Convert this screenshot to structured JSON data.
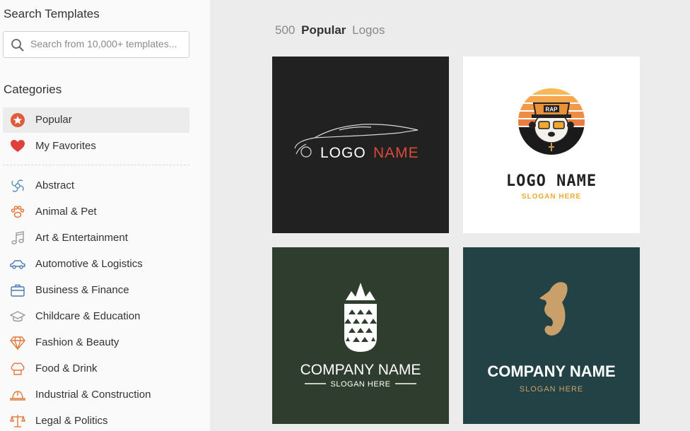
{
  "sidebar": {
    "search_title": "Search Templates",
    "search_placeholder": "Search from 10,000+ templates...",
    "categories_title": "Categories",
    "top_items": [
      {
        "label": "Popular",
        "icon": "star-badge-icon"
      },
      {
        "label": "My Favorites",
        "icon": "heart-icon"
      }
    ],
    "items": [
      {
        "label": "Abstract",
        "icon": "abstract-swirl-icon"
      },
      {
        "label": "Animal & Pet",
        "icon": "paw-icon"
      },
      {
        "label": "Art & Entertainment",
        "icon": "music-note-icon"
      },
      {
        "label": "Automotive & Logistics",
        "icon": "car-icon"
      },
      {
        "label": "Business & Finance",
        "icon": "briefcase-icon"
      },
      {
        "label": "Childcare & Education",
        "icon": "graduation-cap-icon"
      },
      {
        "label": "Fashion & Beauty",
        "icon": "diamond-icon"
      },
      {
        "label": "Food & Drink",
        "icon": "chef-hat-icon"
      },
      {
        "label": "Industrial & Construction",
        "icon": "hard-hat-icon"
      },
      {
        "label": "Legal & Politics",
        "icon": "scales-icon"
      }
    ]
  },
  "main": {
    "count": "500",
    "category": "Popular",
    "suffix": "Logos",
    "cards": [
      {
        "bg": "#212121",
        "name_part1": "LOGO",
        "name_part2": "NAME",
        "accent": "#d94a3a"
      },
      {
        "bg": "#ffffff",
        "name": "LOGO NAME",
        "slogan": "SLOGAN HERE",
        "badge": "RAP",
        "accent": "#f0a830"
      },
      {
        "bg": "#2f3d2e",
        "name": "COMPANY NAME",
        "slogan": "SLOGAN HERE"
      },
      {
        "bg": "#234246",
        "name": "COMPANY NAME",
        "slogan": "SLOGAN HERE",
        "accent": "#c9a06a"
      }
    ]
  }
}
